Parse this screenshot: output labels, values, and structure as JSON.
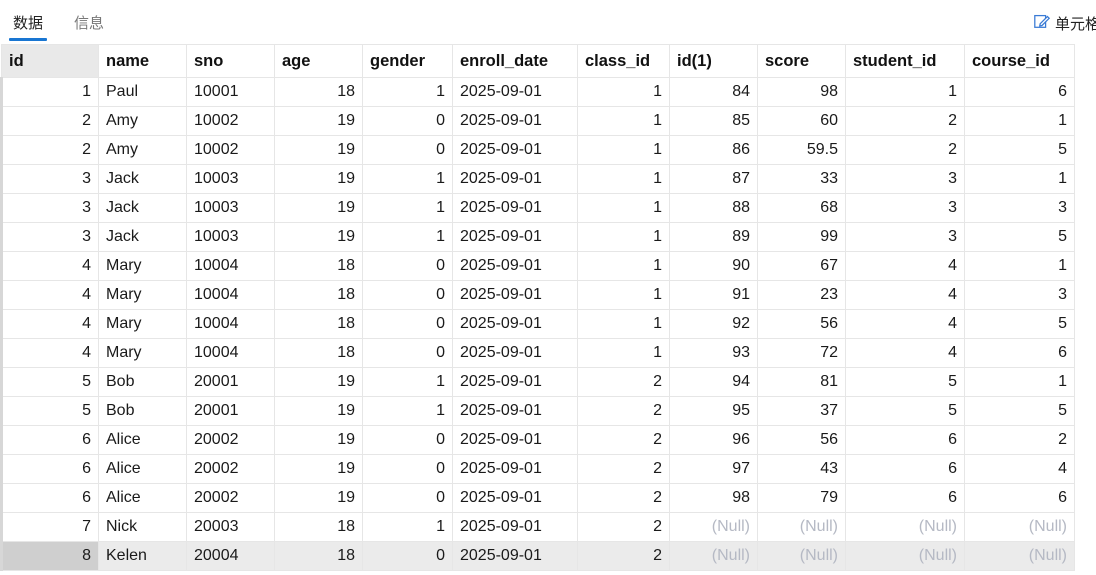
{
  "tabs": [
    {
      "label": "数据",
      "active": true
    },
    {
      "label": "信息",
      "active": false
    }
  ],
  "toolbar": {
    "cell_button_label": "单元格",
    "cell_button_icon": "edit-icon"
  },
  "table": {
    "columns": [
      "id",
      "name",
      "sno",
      "age",
      "gender",
      "enroll_date",
      "class_id",
      "id(1)",
      "score",
      "student_id",
      "course_id"
    ],
    "null_label": "(Null)",
    "selected_row_index": 16,
    "rows": [
      [
        "1",
        "Paul",
        "10001",
        "18",
        "1",
        "2025-09-01",
        "1",
        "84",
        "98",
        "1",
        "6"
      ],
      [
        "2",
        "Amy",
        "10002",
        "19",
        "0",
        "2025-09-01",
        "1",
        "85",
        "60",
        "2",
        "1"
      ],
      [
        "2",
        "Amy",
        "10002",
        "19",
        "0",
        "2025-09-01",
        "1",
        "86",
        "59.5",
        "2",
        "5"
      ],
      [
        "3",
        "Jack",
        "10003",
        "19",
        "1",
        "2025-09-01",
        "1",
        "87",
        "33",
        "3",
        "1"
      ],
      [
        "3",
        "Jack",
        "10003",
        "19",
        "1",
        "2025-09-01",
        "1",
        "88",
        "68",
        "3",
        "3"
      ],
      [
        "3",
        "Jack",
        "10003",
        "19",
        "1",
        "2025-09-01",
        "1",
        "89",
        "99",
        "3",
        "5"
      ],
      [
        "4",
        "Mary",
        "10004",
        "18",
        "0",
        "2025-09-01",
        "1",
        "90",
        "67",
        "4",
        "1"
      ],
      [
        "4",
        "Mary",
        "10004",
        "18",
        "0",
        "2025-09-01",
        "1",
        "91",
        "23",
        "4",
        "3"
      ],
      [
        "4",
        "Mary",
        "10004",
        "18",
        "0",
        "2025-09-01",
        "1",
        "92",
        "56",
        "4",
        "5"
      ],
      [
        "4",
        "Mary",
        "10004",
        "18",
        "0",
        "2025-09-01",
        "1",
        "93",
        "72",
        "4",
        "6"
      ],
      [
        "5",
        "Bob",
        "20001",
        "19",
        "1",
        "2025-09-01",
        "2",
        "94",
        "81",
        "5",
        "1"
      ],
      [
        "5",
        "Bob",
        "20001",
        "19",
        "1",
        "2025-09-01",
        "2",
        "95",
        "37",
        "5",
        "5"
      ],
      [
        "6",
        "Alice",
        "20002",
        "19",
        "0",
        "2025-09-01",
        "2",
        "96",
        "56",
        "6",
        "2"
      ],
      [
        "6",
        "Alice",
        "20002",
        "19",
        "0",
        "2025-09-01",
        "2",
        "97",
        "43",
        "6",
        "4"
      ],
      [
        "6",
        "Alice",
        "20002",
        "19",
        "0",
        "2025-09-01",
        "2",
        "98",
        "79",
        "6",
        "6"
      ],
      [
        "7",
        "Nick",
        "20003",
        "18",
        "1",
        "2025-09-01",
        "2",
        null,
        null,
        null,
        null
      ],
      [
        "8",
        "Kelen",
        "20004",
        "18",
        "0",
        "2025-09-01",
        "2",
        null,
        null,
        null,
        null
      ]
    ]
  }
}
